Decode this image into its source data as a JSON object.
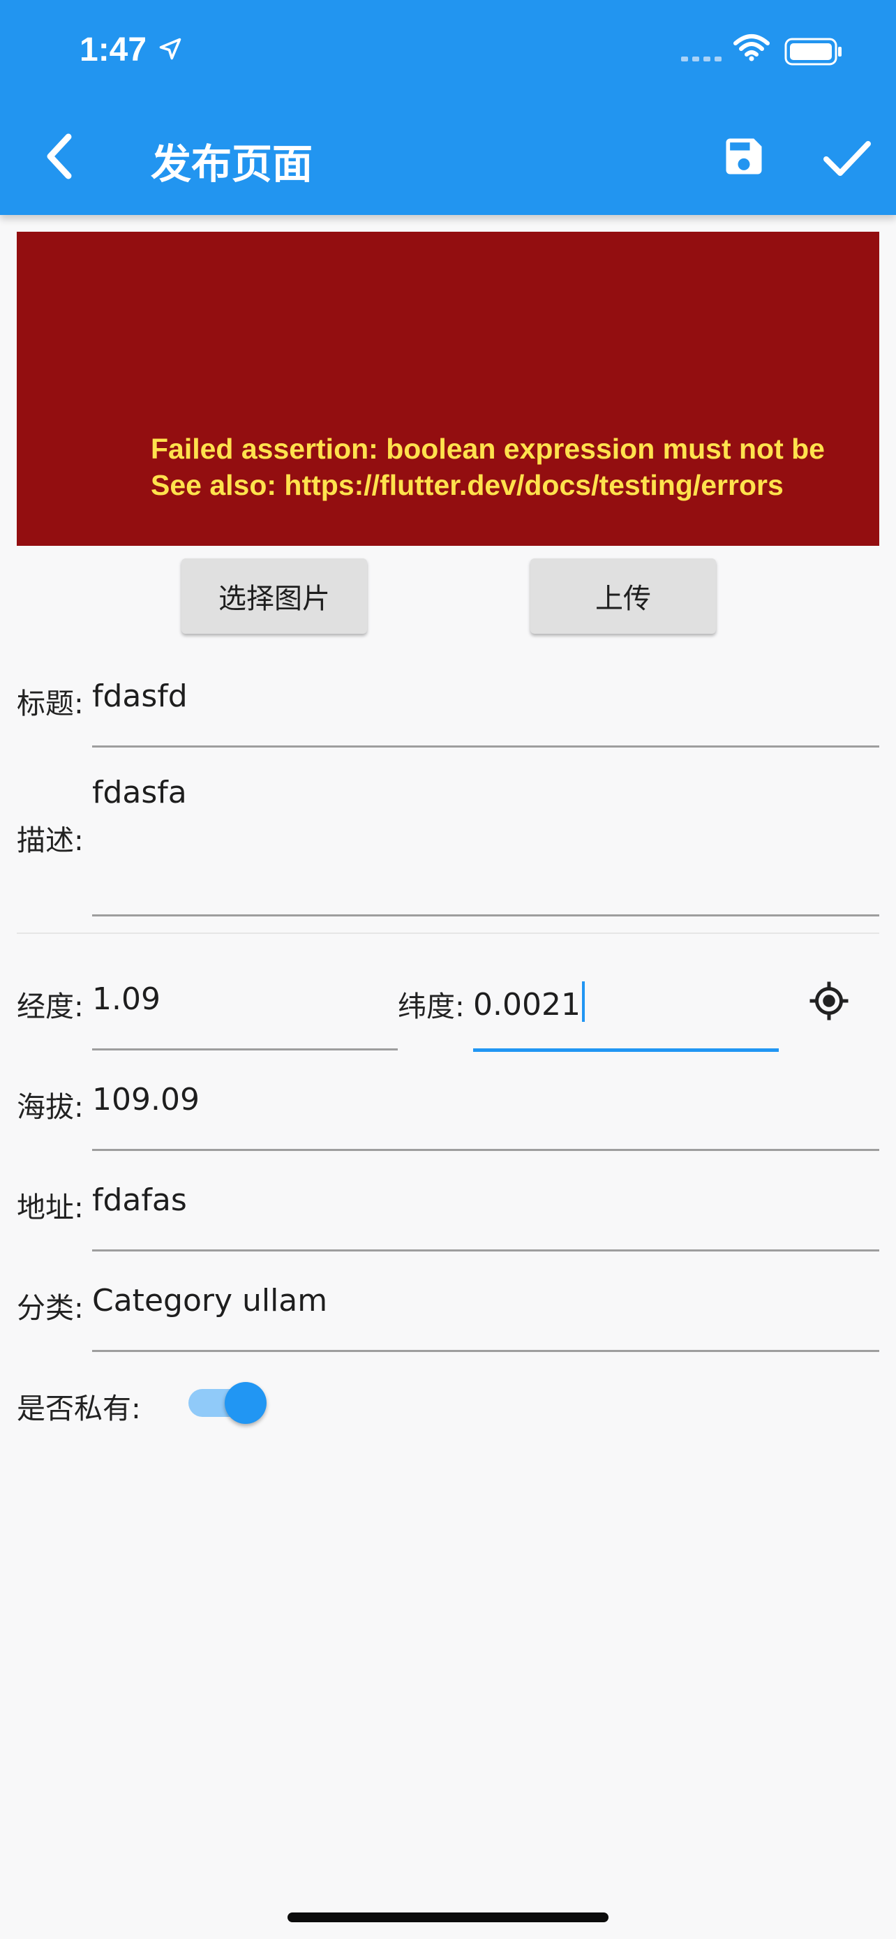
{
  "status_bar": {
    "time": "1:47"
  },
  "appbar": {
    "title": "发布页面"
  },
  "error": {
    "line1": "Failed assertion: boolean expression must not be",
    "line2": "See also: https://flutter.dev/docs/testing/errors"
  },
  "buttons": {
    "pick_image": "选择图片",
    "upload": "上传"
  },
  "form": {
    "title_label": "标题:",
    "title_value": "fdasfd",
    "desc_label": "描述:",
    "desc_value": "fdasfa",
    "lng_label": "经度:",
    "lng_value": "1.09",
    "lat_label": "纬度:",
    "lat_value": "0.0021",
    "alt_label": "海拔:",
    "alt_value": "109.09",
    "addr_label": "地址:",
    "addr_value": "fdafas",
    "cat_label": "分类:",
    "cat_value": "Category ullam",
    "private_label": "是否私有:",
    "private_on": true
  },
  "colors": {
    "primary": "#2295f0",
    "error_bg": "#930e10",
    "error_text": "#ffe24d",
    "switch_track": "#90caf9"
  },
  "icons": [
    "location-arrow-icon",
    "signal-icon",
    "wifi-icon",
    "battery-icon",
    "back-arrow-icon",
    "save-icon",
    "check-icon",
    "my-location-icon"
  ]
}
